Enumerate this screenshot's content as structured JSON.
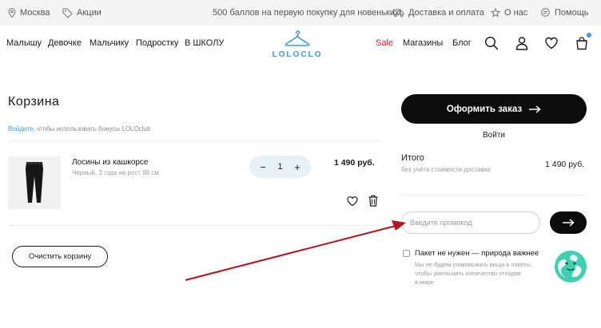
{
  "topbar": {
    "city": "Москва",
    "promos": "Акции",
    "offer": "500 баллов на первую покупку для новеньких!",
    "delivery": "Доставка и оплата",
    "about": "О нас",
    "help": "Помощь"
  },
  "nav": {
    "left": [
      "Малышу",
      "Девочке",
      "Мальчику",
      "Подростку",
      "В ШКОЛУ"
    ],
    "logo": "LOLOCLO",
    "sale": "Sale",
    "stores": "Магазины",
    "blog": "Блог",
    "icons": [
      "search-icon",
      "user-icon",
      "heart-icon",
      "bag-icon"
    ],
    "accent": "#3b9bd8",
    "sale_color": "#e0202a"
  },
  "cart": {
    "title": "Корзина",
    "login_link": "Войдите",
    "bonus_text": ", чтобы использовать бонусы LOLOclub",
    "item": {
      "name": "Лосины из кашкорсе",
      "desc": "Черный, 3 года на рост 98 см.",
      "qty_minus": "−",
      "qty": "1",
      "qty_plus": "+",
      "price": "1 490 руб."
    },
    "clear_label": "Очистить корзину"
  },
  "summary": {
    "checkout_label": "Оформить заказ",
    "login_label": "Войти",
    "total_label": "Итого",
    "total_note": "без учёта стоимости доставки",
    "total_value": "1 490 руб.",
    "promo_placeholder": "Введите промокод",
    "eco_title": "Пакет не нужен — природа важнее",
    "eco_desc_lines": [
      "Мы не будем упаковывать вещи в пакеты,",
      "чтобы уменьшить количество отходов",
      "в мире"
    ]
  },
  "annotation_color": "#b0161c"
}
